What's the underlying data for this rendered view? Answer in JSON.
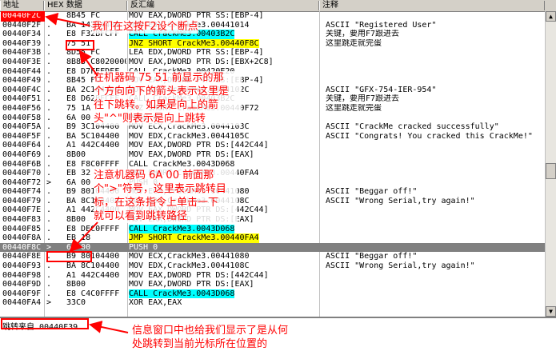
{
  "headers": {
    "address": "地址",
    "hex": "HEX 数据",
    "disasm": "反汇编",
    "comment": "注释"
  },
  "rows": [
    {
      "addr": "00440F2C",
      "mark": "",
      "hex": "8B45 FC",
      "asm": "MOV EAX,DWORD PTR SS:[EBP-4]",
      "cmt": "",
      "addr_red": true
    },
    {
      "addr": "00440F2F",
      "mark": ".",
      "hex": "BA 14104400",
      "asm": "MOV EDX,CrackMe3.00441014",
      "cmt": "ASCII \"Registered User\""
    },
    {
      "addr": "00440F34",
      "mark": ".",
      "hex": "E8 F32BFCFF",
      "asm": "CALL CrackMe3.00403B2C",
      "cmt": "关键，要用F7跟进去",
      "asm_hl": "cyan"
    },
    {
      "addr": "00440F39",
      "mark": ". v",
      "hex": "75 51",
      "asm": "JNZ SHORT CrackMe3.00440F8C",
      "cmt": "这里跳走就完蛋",
      "asm_hl": "yellow"
    },
    {
      "addr": "00440F3B",
      "mark": ".",
      "hex": "8D55 FC",
      "asm": "LEA EDX,DWORD PTR SS:[EBP-4]",
      "cmt": ""
    },
    {
      "addr": "00440F3E",
      "mark": ".",
      "hex": "8B83 C8020000",
      "asm": "MOV EAX,DWORD PTR DS:[EBX+2C8]",
      "cmt": ""
    },
    {
      "addr": "00440F44",
      "mark": ".",
      "hex": "E8 D7FEFDFF",
      "asm": "CALL CrackMe3.00420E20",
      "cmt": ""
    },
    {
      "addr": "00440F49",
      "mark": ".",
      "hex": "8B45 FC",
      "asm": "MOV EAX,DWORD PTR SS:[EBP-4]",
      "cmt": ""
    },
    {
      "addr": "00440F4C",
      "mark": ".",
      "hex": "BA 2C104400",
      "asm": "MOV EDX,CrackMe3.0044102C",
      "cmt": "ASCII \"GFX-754-IER-954\""
    },
    {
      "addr": "00440F51",
      "mark": ".",
      "hex": "E8 D62BFCFF",
      "asm": "CALL CrackMe3.00403B2C",
      "cmt": "关键，要用F7跟进去"
    },
    {
      "addr": "00440F56",
      "mark": ". v",
      "hex": "75 1A",
      "asm": "JNZ SHORT CrackMe3.00440F72",
      "cmt": "这里跳走就完蛋"
    },
    {
      "addr": "00440F58",
      "mark": ".",
      "hex": "6A 00",
      "asm": "PUSH 0",
      "cmt": ""
    },
    {
      "addr": "00440F5A",
      "mark": ".",
      "hex": "B9 3C104400",
      "asm": "MOV ECX,CrackMe3.0044103C",
      "cmt": "ASCII \"CrackMe cracked successfully\""
    },
    {
      "addr": "00440F5F",
      "mark": ".",
      "hex": "BA 5C104400",
      "asm": "MOV EDX,CrackMe3.0044105C",
      "cmt": "ASCII \"Congrats! You cracked this CrackMe!\""
    },
    {
      "addr": "00440F64",
      "mark": ".",
      "hex": "A1 442C4400",
      "asm": "MOV EAX,DWORD PTR DS:[442C44]",
      "cmt": ""
    },
    {
      "addr": "00440F69",
      "mark": ".",
      "hex": "8B00",
      "asm": "MOV EAX,DWORD PTR DS:[EAX]",
      "cmt": ""
    },
    {
      "addr": "00440F6B",
      "mark": ".",
      "hex": "E8 F8C0FFFF",
      "asm": "CALL CrackMe3.0043D068",
      "cmt": ""
    },
    {
      "addr": "00440F70",
      "mark": ". v",
      "hex": "EB 32",
      "asm": "JMP SHORT CrackMe3.00440FA4",
      "cmt": ""
    },
    {
      "addr": "00440F72",
      "mark": ">",
      "hex": "6A 00",
      "asm": "PUSH 0",
      "cmt": ""
    },
    {
      "addr": "00440F74",
      "mark": ".",
      "hex": "B9 80104400",
      "asm": "MOV ECX,CrackMe3.00441080",
      "cmt": "ASCII \"Beggar off!\""
    },
    {
      "addr": "00440F79",
      "mark": ".",
      "hex": "BA 8C104400",
      "asm": "MOV EDX,CrackMe3.0044108C",
      "cmt": "ASCII \"Wrong Serial,try again!\""
    },
    {
      "addr": "00440F7E",
      "mark": ".",
      "hex": "A1 442C4400",
      "asm": "MOV EAX,DWORD PTR DS:[442C44]",
      "cmt": ""
    },
    {
      "addr": "00440F83",
      "mark": ".",
      "hex": "8B00",
      "asm": "MOV EAX,DWORD PTR DS:[EAX]",
      "cmt": ""
    },
    {
      "addr": "00440F85",
      "mark": ".",
      "hex": "E8 DEC0FFFF",
      "asm": "CALL CrackMe3.0043D068",
      "cmt": "",
      "asm_hl": "cyan"
    },
    {
      "addr": "00440F8A",
      "mark": ". v",
      "hex": "EB 18",
      "asm": "JMP SHORT CrackMe3.00440FA4",
      "cmt": "",
      "asm_hl": "yellow"
    },
    {
      "addr": "00440F8C",
      "mark": "> ",
      "hex": "6A 00",
      "asm": "PUSH 0",
      "cmt": "",
      "selected": true
    },
    {
      "addr": "00440F8E",
      "mark": ".",
      "hex": "B9 80104400",
      "asm": "MOV ECX,CrackMe3.00441080",
      "cmt": "ASCII \"Beggar off!\""
    },
    {
      "addr": "00440F93",
      "mark": ".",
      "hex": "BA 8C104400",
      "asm": "MOV EDX,CrackMe3.0044108C",
      "cmt": "ASCII \"Wrong Serial,try again!\""
    },
    {
      "addr": "00440F98",
      "mark": ".",
      "hex": "A1 442C4400",
      "asm": "MOV EAX,DWORD PTR DS:[442C44]",
      "cmt": ""
    },
    {
      "addr": "00440F9D",
      "mark": ".",
      "hex": "8B00",
      "asm": "MOV EAX,DWORD PTR DS:[EAX]",
      "cmt": ""
    },
    {
      "addr": "00440F9F",
      "mark": ".",
      "hex": "E8 C4C0FFFF",
      "asm": "CALL CrackMe3.0043D068",
      "cmt": "",
      "asm_hl": "cyan"
    },
    {
      "addr": "00440FA4",
      "mark": ">",
      "hex": "33C0",
      "asm": "XOR EAX,EAX",
      "cmt": ""
    }
  ],
  "info": {
    "text": "跳转来自 00440F39"
  },
  "annotations": {
    "note1": "我们在这按F2设个断点",
    "note2a": "在机器码 75 51 前显示的那",
    "note2b": "个方向向下的箭头表示这里是",
    "note2c": "往下跳转。如果是向上的箭",
    "note2d": "头\"^\"则表示是向上跳转",
    "note3a": "注意机器码 6A 00 前面那",
    "note3b": "个\">\"符号，这里表示跳转目",
    "note3c": "标，在这条指令上单击一下",
    "note3d": "就可以看到跳转路径",
    "note4a": "信息窗口中也给我们显示了是从何",
    "note4b": "处跳转到当前光标所在位置的"
  },
  "colors": {
    "annotation": "#ff0000",
    "call_highlight": "#00ffff",
    "jump_highlight": "#ffff00",
    "selected_row": "#808080"
  }
}
